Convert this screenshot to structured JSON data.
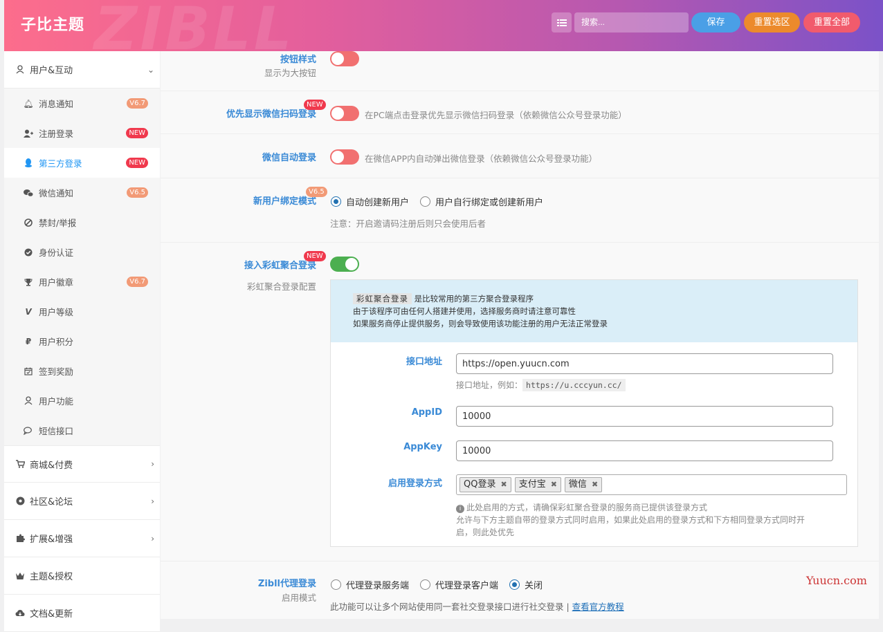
{
  "header": {
    "brand": "子比主题",
    "watermark": "ZIBLL",
    "search_placeholder": "搜索...",
    "save_label": "保存",
    "reset_section_label": "重置选区",
    "reset_all_label": "重置全部",
    "colors": {
      "save": "#4a9fe6",
      "reset_section": "#ec8a2c",
      "reset_all": "#f15b6c"
    }
  },
  "sidebar": {
    "groups": [
      {
        "label": "用户&互动",
        "icon": "user-icon",
        "expanded": true
      },
      {
        "label": "商城&付费",
        "icon": "cart-icon"
      },
      {
        "label": "社区&论坛",
        "icon": "community-icon"
      },
      {
        "label": "扩展&增强",
        "icon": "puzzle-icon"
      },
      {
        "label": "主题&授权",
        "icon": "crown-icon"
      },
      {
        "label": "文档&更新",
        "icon": "cloud-download-icon"
      }
    ],
    "items": [
      {
        "label": "消息通知",
        "icon": "bell-icon",
        "badge": "V6.7"
      },
      {
        "label": "注册登录",
        "icon": "user-plus-icon",
        "badge": "NEW"
      },
      {
        "label": "第三方登录",
        "icon": "qq-icon",
        "badge": "NEW",
        "active": true
      },
      {
        "label": "微信通知",
        "icon": "wechat-icon",
        "badge": "V6.5"
      },
      {
        "label": "禁封/举报",
        "icon": "ban-icon"
      },
      {
        "label": "身份认证",
        "icon": "check-badge-icon"
      },
      {
        "label": "用户徽章",
        "icon": "trophy-icon",
        "badge": "V6.7"
      },
      {
        "label": "用户等级",
        "icon": "vimeo-icon"
      },
      {
        "label": "用户积分",
        "icon": "ruble-icon"
      },
      {
        "label": "签到奖励",
        "icon": "calendar-check-icon"
      },
      {
        "label": "用户功能",
        "icon": "user-outline-icon"
      },
      {
        "label": "短信接口",
        "icon": "chat-icon"
      }
    ]
  },
  "main": {
    "button_style": {
      "label": "按钮样式",
      "sublabel": "显示为大按钮",
      "on": false
    },
    "wechat_qr_first": {
      "label": "优先显示微信扫码登录",
      "tag": "NEW",
      "on": false,
      "desc": "在PC端点击登录优先显示微信扫码登录（依赖微信公众号登录功能）"
    },
    "wechat_auto": {
      "label": "微信自动登录",
      "on": false,
      "desc": "在微信APP内自动弹出微信登录（依赖微信公众号登录功能）"
    },
    "new_user_bind": {
      "label": "新用户绑定模式",
      "tag": "V6.5",
      "options": [
        "自动创建新用户",
        "用户自行绑定或创建新用户"
      ],
      "selected": 0,
      "note": "注意：开启邀请码注册后则只会使用后者"
    },
    "rainbow": {
      "label": "接入彩虹聚合登录",
      "tag": "NEW",
      "sublabel": "彩虹聚合登录配置",
      "on": true,
      "notice_chip": "彩虹聚合登录",
      "notice_line1": "是比较常用的第三方聚合登录程序",
      "notice_line2": "由于该程序可由任何人搭建并使用，选择服务商时请注意可靠性",
      "notice_line3": "如果服务商停止提供服务，则会导致使用该功能注册的用户无法正常登录",
      "api_label": "接口地址",
      "api_value": "https://open.yuucn.com",
      "api_hint": "接口地址，例如：",
      "api_example": "https://u.cccyun.cc/",
      "appid_label": "AppID",
      "appid_value": "10000",
      "appkey_label": "AppKey",
      "appkey_value": "10000",
      "methods_label": "启用登录方式",
      "methods": [
        "QQ登录",
        "支付宝",
        "微信"
      ],
      "methods_hint1": "此处启用的方式，请确保彩虹聚合登录的服务商已提供该登录方式",
      "methods_hint2": "允许与下方主题自带的登录方式同时启用，如果此处启用的登录方式和下方相同登录方式同时开",
      "methods_hint3": "启，则此处优先"
    },
    "zibll_proxy": {
      "label": "Zibll代理登录",
      "sublabel": "启用模式",
      "options": [
        "代理登录服务端",
        "代理登录客户端",
        "关闭"
      ],
      "selected": 2,
      "desc": "此功能可以让多个网站使用同一套社交登录接口进行社交登录 |",
      "link": "查看官方教程"
    }
  },
  "watermark_site": "Yuucn.com"
}
